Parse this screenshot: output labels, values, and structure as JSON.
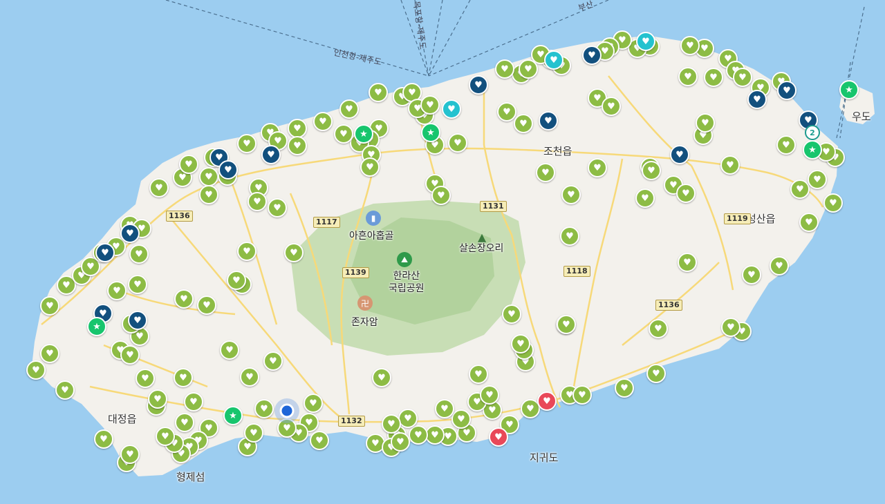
{
  "map": {
    "colors": {
      "sea": "#9ccdf0",
      "land": "#f3f1ec",
      "park": "#b9d7a3",
      "road": "#f7d979",
      "fav": "#8dbc45",
      "saved": "#12507e",
      "visited": "#24c2cf",
      "hot": "#e94858",
      "star": "#17c56d"
    },
    "place_labels": {
      "jocheon": "조천읍",
      "seongsan": "성산읍",
      "udo": "우도",
      "daejeong": "대정읍",
      "hyeongjeseom": "형제섬",
      "jigwido": "지귀도"
    },
    "poi": {
      "aheun": {
        "label": "아흔아홉골",
        "icon": "building-icon"
      },
      "salson": {
        "label": "살손장오리",
        "icon": "mountain-icon"
      },
      "hallasan": {
        "label": "한라산\n국립공원",
        "icon": "park-icon"
      },
      "jonjaam": {
        "label": "존자암",
        "icon": "temple-icon"
      }
    },
    "road_numbers": {
      "r1136a": "1136",
      "r1117": "1117",
      "r1131": "1131",
      "r1139": "1139",
      "r1118": "1118",
      "r1119": "1119",
      "r1136b": "1136",
      "r1132": "1132"
    },
    "ferry_routes": {
      "incheon": "인천항-제주도",
      "mokpo": "목포항-제주도",
      "busan": "부산"
    },
    "cluster_count": "2",
    "marker_symbols": {
      "green": "♥",
      "navy": "♥",
      "teal": "♥",
      "red": "♥",
      "star": "★"
    }
  }
}
